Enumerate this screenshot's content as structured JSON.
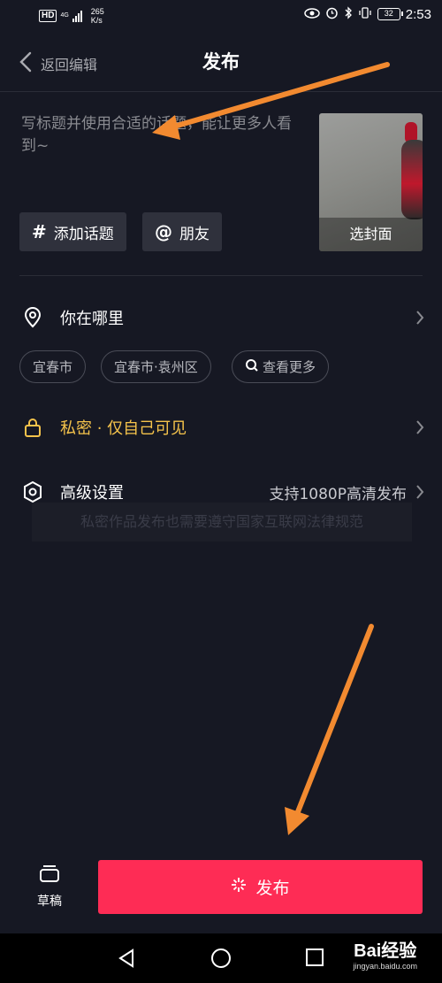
{
  "status_bar": {
    "hd": "HD",
    "network": "4G",
    "speed_value": "265",
    "speed_unit": "K/s",
    "battery": "32",
    "time": "2:53"
  },
  "header": {
    "back_label": "返回编辑",
    "title": "发布"
  },
  "caption": {
    "placeholder": "写标题并使用合适的话题，能让更多人看到~"
  },
  "cover": {
    "label": "选封面"
  },
  "tag_buttons": {
    "topic": {
      "symbol": "#",
      "label": "添加话题"
    },
    "friend": {
      "symbol": "@",
      "label": "朋友"
    }
  },
  "location": {
    "label": "你在哪里",
    "chips": [
      "宜春市",
      "宜春市·袁州区",
      "查看更多"
    ]
  },
  "privacy": {
    "label": "私密 · 仅自己可见",
    "color": "#f5c34b"
  },
  "advanced": {
    "label": "高级设置",
    "value": "支持1080P高清发布"
  },
  "notice": {
    "text": "私密作品发布也需要遵守国家互联网法律规范"
  },
  "bottom": {
    "draft_label": "草稿",
    "publish_label": "发布",
    "publish_color": "#fe2c55"
  },
  "watermark": {
    "brand": "Bai经验",
    "url": "jingyan.baidu.com"
  },
  "colors": {
    "background": "#161823",
    "annotation_arrow": "#f28a30"
  }
}
